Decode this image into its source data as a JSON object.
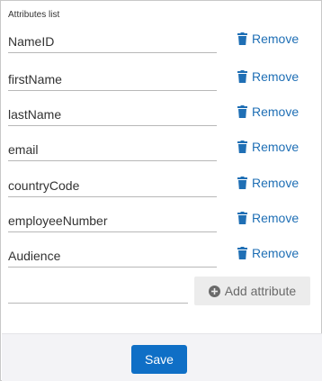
{
  "attributes_list": {
    "title": "Attributes list",
    "items": [
      {
        "name": "NameID",
        "remove_label": "Remove"
      },
      {
        "name": "firstName",
        "remove_label": "Remove"
      },
      {
        "name": "lastName",
        "remove_label": "Remove"
      },
      {
        "name": "email",
        "remove_label": "Remove"
      },
      {
        "name": "countryCode",
        "remove_label": "Remove"
      },
      {
        "name": "employeeNumber",
        "remove_label": "Remove"
      },
      {
        "name": "Audience",
        "remove_label": "Remove"
      }
    ],
    "new_attribute_value": "",
    "add_label": "Add attribute"
  },
  "footer": {
    "save_label": "Save"
  },
  "icons": {
    "remove": "trash-icon",
    "add": "plus-circle-icon"
  },
  "colors": {
    "link": "#1f6fb5",
    "primary_button": "#0f6fc6",
    "secondary_button_bg": "#ececec",
    "footer_bg": "#f3f3f6"
  }
}
